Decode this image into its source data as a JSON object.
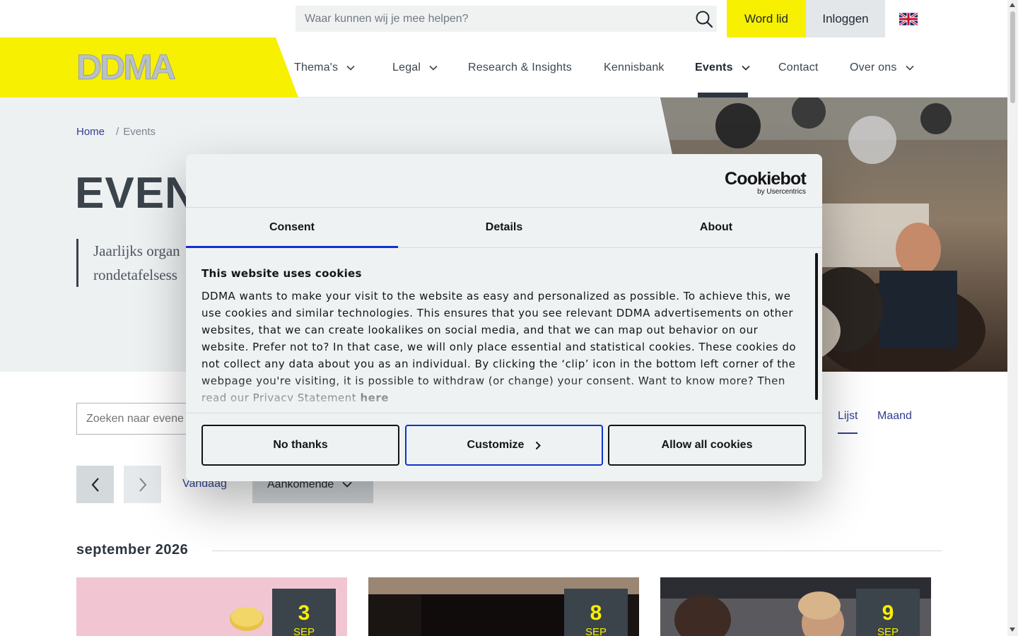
{
  "topbar": {
    "search_placeholder": "Waar kunnen wij je mee helpen?",
    "join_label": "Word lid",
    "login_label": "Inloggen",
    "language_flag": "uk-flag-icon"
  },
  "nav": {
    "logo_text": "DDMA",
    "items": [
      {
        "label": "Thema's",
        "has_dropdown": true
      },
      {
        "label": "Legal",
        "has_dropdown": true
      },
      {
        "label": "Research & Insights",
        "has_dropdown": false
      },
      {
        "label": "Kennisbank",
        "has_dropdown": false
      },
      {
        "label": "Events",
        "has_dropdown": true,
        "active": true
      },
      {
        "label": "Contact",
        "has_dropdown": false
      },
      {
        "label": "Over ons",
        "has_dropdown": true
      }
    ]
  },
  "hero": {
    "breadcrumb": {
      "home": "Home",
      "current": "Events"
    },
    "title": "EVEN",
    "intro_line1": "Jaarlijks organ",
    "intro_line2": "rondetafelsess"
  },
  "filters": {
    "search_placeholder": "Zoeken naar evene",
    "view_list": "Lijst",
    "view_month": "Maand",
    "today_label": "Vandaag",
    "upcoming_label": "Aankomende"
  },
  "events": {
    "month_heading": "september 2026",
    "cards": [
      {
        "day": "3",
        "month": "SEP"
      },
      {
        "day": "8",
        "month": "SEP"
      },
      {
        "day": "9",
        "month": "SEP"
      }
    ]
  },
  "cookie": {
    "brand": "Cookiebot",
    "brand_sub": "by Usercentrics",
    "tabs": [
      "Consent",
      "Details",
      "About"
    ],
    "heading": "This website uses cookies",
    "body": "DDMA wants to make your visit to the website as easy and personalized as possible. To achieve this, we use cookies and similar technologies. This ensures that you see relevant DDMA advertisements on other websites, that we can create lookalikes on social media, and that we can map out behavior on our website. Prefer not to? In that case, we will only place essential and statistical cookies. These cookies do not collect any data about you as an individual. By clicking the ‘clip’ icon in the bottom left corner of the webpage you're visiting, it is possible to withdraw (or change) your consent. Want to know more? Then read our Privacy Statement",
    "link": "here",
    "btn_no": "No thanks",
    "btn_customize": "Customize",
    "btn_allow": "Allow all cookies"
  },
  "colors": {
    "brand_yellow": "#f7f000",
    "dark": "#3b434b",
    "link_blue": "#2f3f8f",
    "cookie_accent": "#1032cf"
  }
}
